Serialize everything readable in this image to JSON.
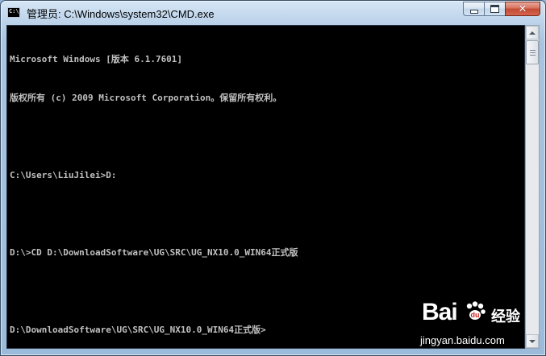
{
  "window": {
    "title": "管理员: C:\\Windows\\system32\\CMD.exe",
    "icon": "cmd-icon",
    "icon_glyph": "C:\\",
    "controls": {
      "minimize": "minimize-icon",
      "maximize": "maximize-icon",
      "close": "close-icon",
      "close_glyph": "✕"
    }
  },
  "console": {
    "background": "#000000",
    "foreground": "#c0c0c0",
    "lines": [
      "Microsoft Windows [版本 6.1.7601]",
      "版权所有 (c) 2009 Microsoft Corporation。保留所有权利。",
      "",
      "C:\\Users\\LiuJilei>D:",
      "",
      "D:\\>CD D:\\DownloadSoftware\\UG\\SRC\\UG_NX10.0_WIN64正式版",
      "",
      "D:\\DownloadSoftware\\UG\\SRC\\UG_NX10.0_WIN64正式版>"
    ]
  },
  "watermark": {
    "logo": "Bai",
    "logo_suffix": "经验",
    "url": "jingyan.baidu.com"
  }
}
